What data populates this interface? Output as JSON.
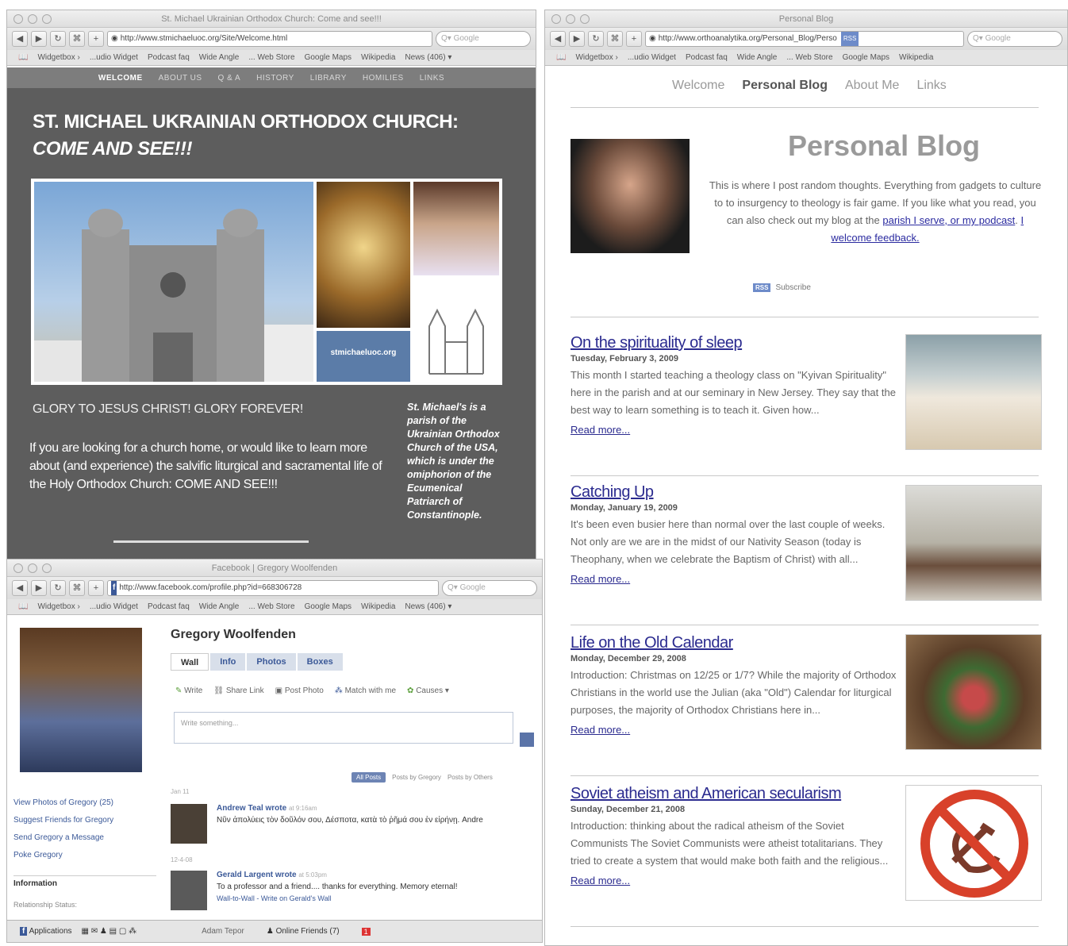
{
  "church_window": {
    "title": "St. Michael Ukrainian Orthodox Church: Come and see!!!",
    "url": "http://www.stmichaeluoc.org/Site/Welcome.html",
    "search_placeholder": "Google",
    "nav": [
      "WELCOME",
      "ABOUT US",
      "Q & A",
      "HISTORY",
      "LIBRARY",
      "HOMILIES",
      "LINKS"
    ],
    "heading_line1": "ST. MICHAEL UKRAINIAN ORTHODOX CHURCH:",
    "heading_line2": "COME AND SEE!!!",
    "logo_text": "stmichaeluoc.org",
    "glory": "GLORY TO JESUS CHRIST!  GLORY FOREVER!",
    "body_text": "If you are looking for a church home, or would like to learn more about (and experience)  the salvific liturgical and sacramental life of the Holy Orthodox Church: COME AND SEE!!!",
    "side_text": "St. Michael's is a parish of the Ukrainian Orthodox Church of the USA, which is under the omiphorion of the Ecumenical Patriarch of Constantinople."
  },
  "bookmarks": [
    "Widgetbox ›",
    "...udio Widget",
    "Podcast faq",
    "Wide Angle",
    "... Web Store",
    "Google Maps",
    "Wikipedia",
    "News (406) ▾"
  ],
  "facebook_window": {
    "title": "Facebook | Gregory Woolfenden",
    "url": "http://www.facebook.com/profile.php?id=668306728",
    "search_placeholder": "Google",
    "profile_name": "Gregory Woolfenden",
    "tabs": [
      "Wall",
      "Info",
      "Photos",
      "Boxes"
    ],
    "actions": [
      "Write",
      "Share Link",
      "Post Photo",
      "Match with me",
      "Causes"
    ],
    "write_placeholder": "Write something...",
    "filters": [
      "All Posts",
      "Posts by Gregory",
      "Posts by Others"
    ],
    "left_links": [
      "View Photos of Gregory (25)",
      "Suggest Friends for Gregory",
      "Send Gregory a Message",
      "Poke Gregory"
    ],
    "info_heading": "Information",
    "rel_status": "Relationship Status:",
    "date1": "Jan 11",
    "post1_author": "Andrew Teal wrote",
    "post1_time": "at 9:16am",
    "post1_text": "Νῦν ἀπολύεις τὸν δοῦλόν σου, Δέσποτα, κατὰ τὸ ῥῆμά σου ἐν εἰρήνῃ. Andre",
    "date2": "12-4-08",
    "post2_author": "Gerald Largent wrote",
    "post2_time": "at 5:03pm",
    "post2_text": "To a professor and a friend.... thanks for everything. Memory eternal!",
    "post2_links": "Wall-to-Wall - Write on Gerald's Wall",
    "bottom_apps": "Applications",
    "bottom_user": "Adam Tepor",
    "bottom_online": "Online Friends (7)",
    "bottom_count": "1"
  },
  "blog_window": {
    "title": "Personal Blog",
    "url": "http://www.orthoanalytika.org/Personal_Blog/Perso",
    "search_placeholder": "Google",
    "rss_badge": "RSS",
    "bookmarks": [
      "Widgetbox ›",
      "...udio Widget",
      "Podcast faq",
      "Wide Angle",
      "... Web Store",
      "Google Maps",
      "Wikipedia"
    ],
    "nav": [
      "Welcome",
      "Personal Blog",
      "About Me",
      "Links"
    ],
    "heading": "Personal Blog",
    "intro_text": "This is where I post random thoughts.  Everything from gadgets to culture to to insurgency to theology is fair game.  If you like what you read, you can also check out my blog at the ",
    "intro_link1": "parish I serve, or my podcast",
    "intro_link2": "I welcome feedback.",
    "subscribe": "Subscribe",
    "posts": [
      {
        "title": "On the spirituality of sleep",
        "date": "Tuesday, February 3, 2009",
        "excerpt": "This month I started teaching a theology class on \"Kyivan Spirituality\" here in the parish and at our seminary in New Jersey.  They say that the best way to learn something is to teach it. Given how...",
        "more": "Read more..."
      },
      {
        "title": "Catching Up",
        "date": "Monday, January 19, 2009",
        "excerpt": "It's been even busier here than normal over the last couple of weeks. Not only are we are in the midst of our Nativity Season (today is Theophany, when we celebrate the Baptism of Christ) with all...",
        "more": "Read more..."
      },
      {
        "title": "Life on the Old Calendar",
        "date": "Monday, December 29, 2008",
        "excerpt": "Introduction: Christmas on 12/25 or 1/7? While the majority of Orthodox Christians in the world use the Julian (aka \"Old\") Calendar for liturgical purposes, the majority of Orthodox Christians here in...",
        "more": "Read more..."
      },
      {
        "title": "Soviet atheism and American secularism",
        "date": "Sunday, December 21, 2008",
        "excerpt": "Introduction: thinking about the radical atheism of the Soviet Communists The Soviet Communists were atheist totalitarians. They tried to create a system that would make both faith and the religious...",
        "more": "Read more..."
      }
    ]
  }
}
